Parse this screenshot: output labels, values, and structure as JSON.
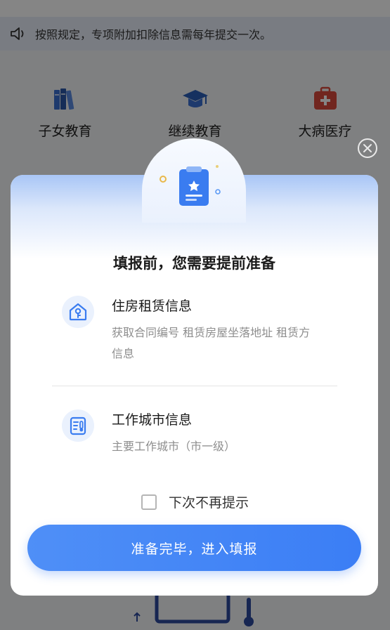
{
  "background": {
    "notice": {
      "text": "按照规定，专项附加扣除信息需每年提交一次。",
      "icon": "speaker-icon"
    },
    "categories": [
      {
        "label": "子女教育",
        "icon": "books-icon",
        "color": "#3b6fd1"
      },
      {
        "label": "继续教育",
        "icon": "graduation-cap-icon",
        "color": "#2b5fb8"
      },
      {
        "label": "大病医疗",
        "icon": "medical-kit-icon",
        "color": "#d94a3d"
      }
    ]
  },
  "dialog": {
    "title": "填报前，您需要提前准备",
    "badge_icon": "clipboard-star-icon",
    "items": [
      {
        "icon": "house-key-icon",
        "title": "住房租赁信息",
        "desc": "获取合同编号 租赁房屋坐落地址 租赁方信息"
      },
      {
        "icon": "document-thermometer-icon",
        "title": "工作城市信息",
        "desc": "主要工作城市（市一级）"
      }
    ],
    "remember": {
      "label": "下次不再提示",
      "checked": false
    },
    "primary_button": "准备完毕，进入填报",
    "close_icon": "close-icon"
  },
  "colors": {
    "accent": "#3b7ef5",
    "icon_blue": "#3a7cf0",
    "icon_bg": "#eaf1fd"
  }
}
